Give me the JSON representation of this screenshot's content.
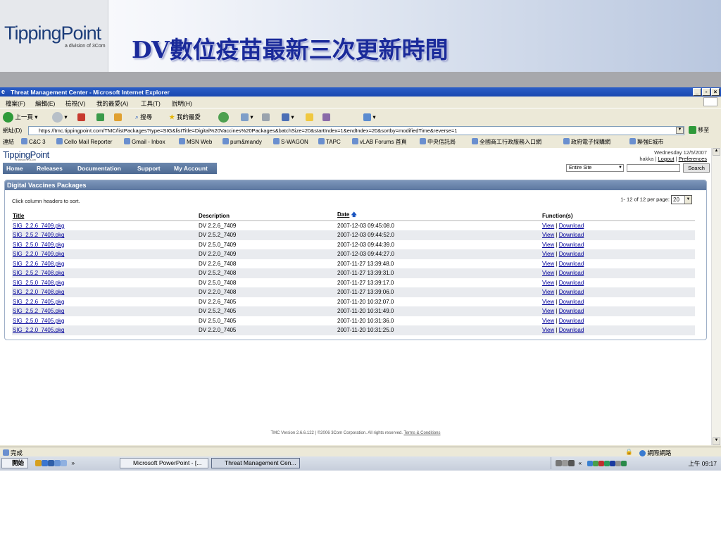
{
  "slide": {
    "logo_main": "TippingPoint",
    "logo_sub": "a division of 3Com",
    "title": "DV數位疫苗最新三次更新時間"
  },
  "browser": {
    "window_title": "Threat Management Center - Microsoft Internet Explorer",
    "menu": [
      "檔案(F)",
      "編輯(E)",
      "檢視(V)",
      "我的最愛(A)",
      "工具(T)",
      "說明(H)"
    ],
    "toolbar": {
      "back": "上一頁",
      "search": "搜尋",
      "favorites": "我的最愛"
    },
    "address_label": "網址(D)",
    "address_url": "https://tmc.tippingpoint.com/TMC/listPackages?type=SIG&listTitle=Digital%20Vaccines%20Packages&batchSize=20&startIndex=1&endIndex=20&sortby=modifiedTime&reverse=1",
    "go_label": "移至",
    "links_label": "連結",
    "links": [
      "C&C 3",
      "Cello Mail Reporter",
      "Gmail - Inbox",
      "MSN Web",
      "pum&mandy",
      "S-WAGON",
      "TAPC",
      "vLAB Forums 首頁",
      "中央信託局",
      "全國商工行政服務入口網",
      "政府電子採購網",
      "聯強E城市"
    ]
  },
  "site": {
    "logo": "TippingPoint",
    "logo_sub": "a division of 3Com",
    "date": "Wednesday 12/5/2007",
    "user": "hakka",
    "logout": "Logout",
    "preferences": "Preferences",
    "nav": [
      "Home",
      "Releases",
      "Documentation",
      "Support",
      "My Account"
    ],
    "search_scope": "Entire Site",
    "search_button": "Search"
  },
  "panel": {
    "title": "Digital Vaccines Packages",
    "hint": "Click column headers to sort.",
    "paging_text": "1- 12 of 12 per page:",
    "per_page": "20",
    "columns": [
      "Title",
      "Description",
      "Date",
      "Function(s)"
    ],
    "rows": [
      {
        "title": "SIG_2.2.6_7409.pkg",
        "desc": "DV 2.2.6_7409",
        "date": "2007-12-03 09:45:08.0"
      },
      {
        "title": "SIG_2.5.2_7409.pkg",
        "desc": "DV 2.5.2_7409",
        "date": "2007-12-03 09:44:52.0"
      },
      {
        "title": "SIG_2.5.0_7409.pkg",
        "desc": "DV 2.5.0_7409",
        "date": "2007-12-03 09:44:39.0"
      },
      {
        "title": "SIG_2.2.0_7409.pkg",
        "desc": "DV 2.2.0_7409",
        "date": "2007-12-03 09:44:27.0"
      },
      {
        "title": "SIG_2.2.6_7408.pkg",
        "desc": "DV 2.2.6_7408",
        "date": "2007-11-27 13:39:48.0"
      },
      {
        "title": "SIG_2.5.2_7408.pkg",
        "desc": "DV 2.5.2_7408",
        "date": "2007-11-27 13:39:31.0"
      },
      {
        "title": "SIG_2.5.0_7408.pkg",
        "desc": "DV 2.5.0_7408",
        "date": "2007-11-27 13:39:17.0"
      },
      {
        "title": "SIG_2.2.0_7408.pkg",
        "desc": "DV 2.2.0_7408",
        "date": "2007-11-27 13:39:06.0"
      },
      {
        "title": "SIG_2.2.6_7405.pkg",
        "desc": "DV 2.2.6_7405",
        "date": "2007-11-20 10:32:07.0"
      },
      {
        "title": "SIG_2.5.2_7405.pkg",
        "desc": "DV 2.5.2_7405",
        "date": "2007-11-20 10:31:49.0"
      },
      {
        "title": "SIG_2.5.0_7405.pkg",
        "desc": "DV 2.5.0_7405",
        "date": "2007-11-20 10:31:36.0"
      },
      {
        "title": "SIG_2.2.0_7405.pkg",
        "desc": "DV 2.2.0_7405",
        "date": "2007-11-20 10:31:25.0"
      }
    ],
    "view_label": "View",
    "download_label": "Download"
  },
  "footer": {
    "text": "TMC Version 2.6.6.122 | ©2006 3Com Corporation. All rights reserved.",
    "terms": "Terms & Conditions"
  },
  "status": {
    "left": "完成",
    "zone": "網際網路"
  },
  "taskbar": {
    "start": "開始",
    "tasks": [
      "Microsoft PowerPoint - [...",
      "Threat Management Cen..."
    ],
    "clock": "上午 09:17"
  },
  "colors": {
    "title_blue": "#1a2a9a",
    "nav_bar": "#5c77a0",
    "link_blue": "#00009a"
  }
}
